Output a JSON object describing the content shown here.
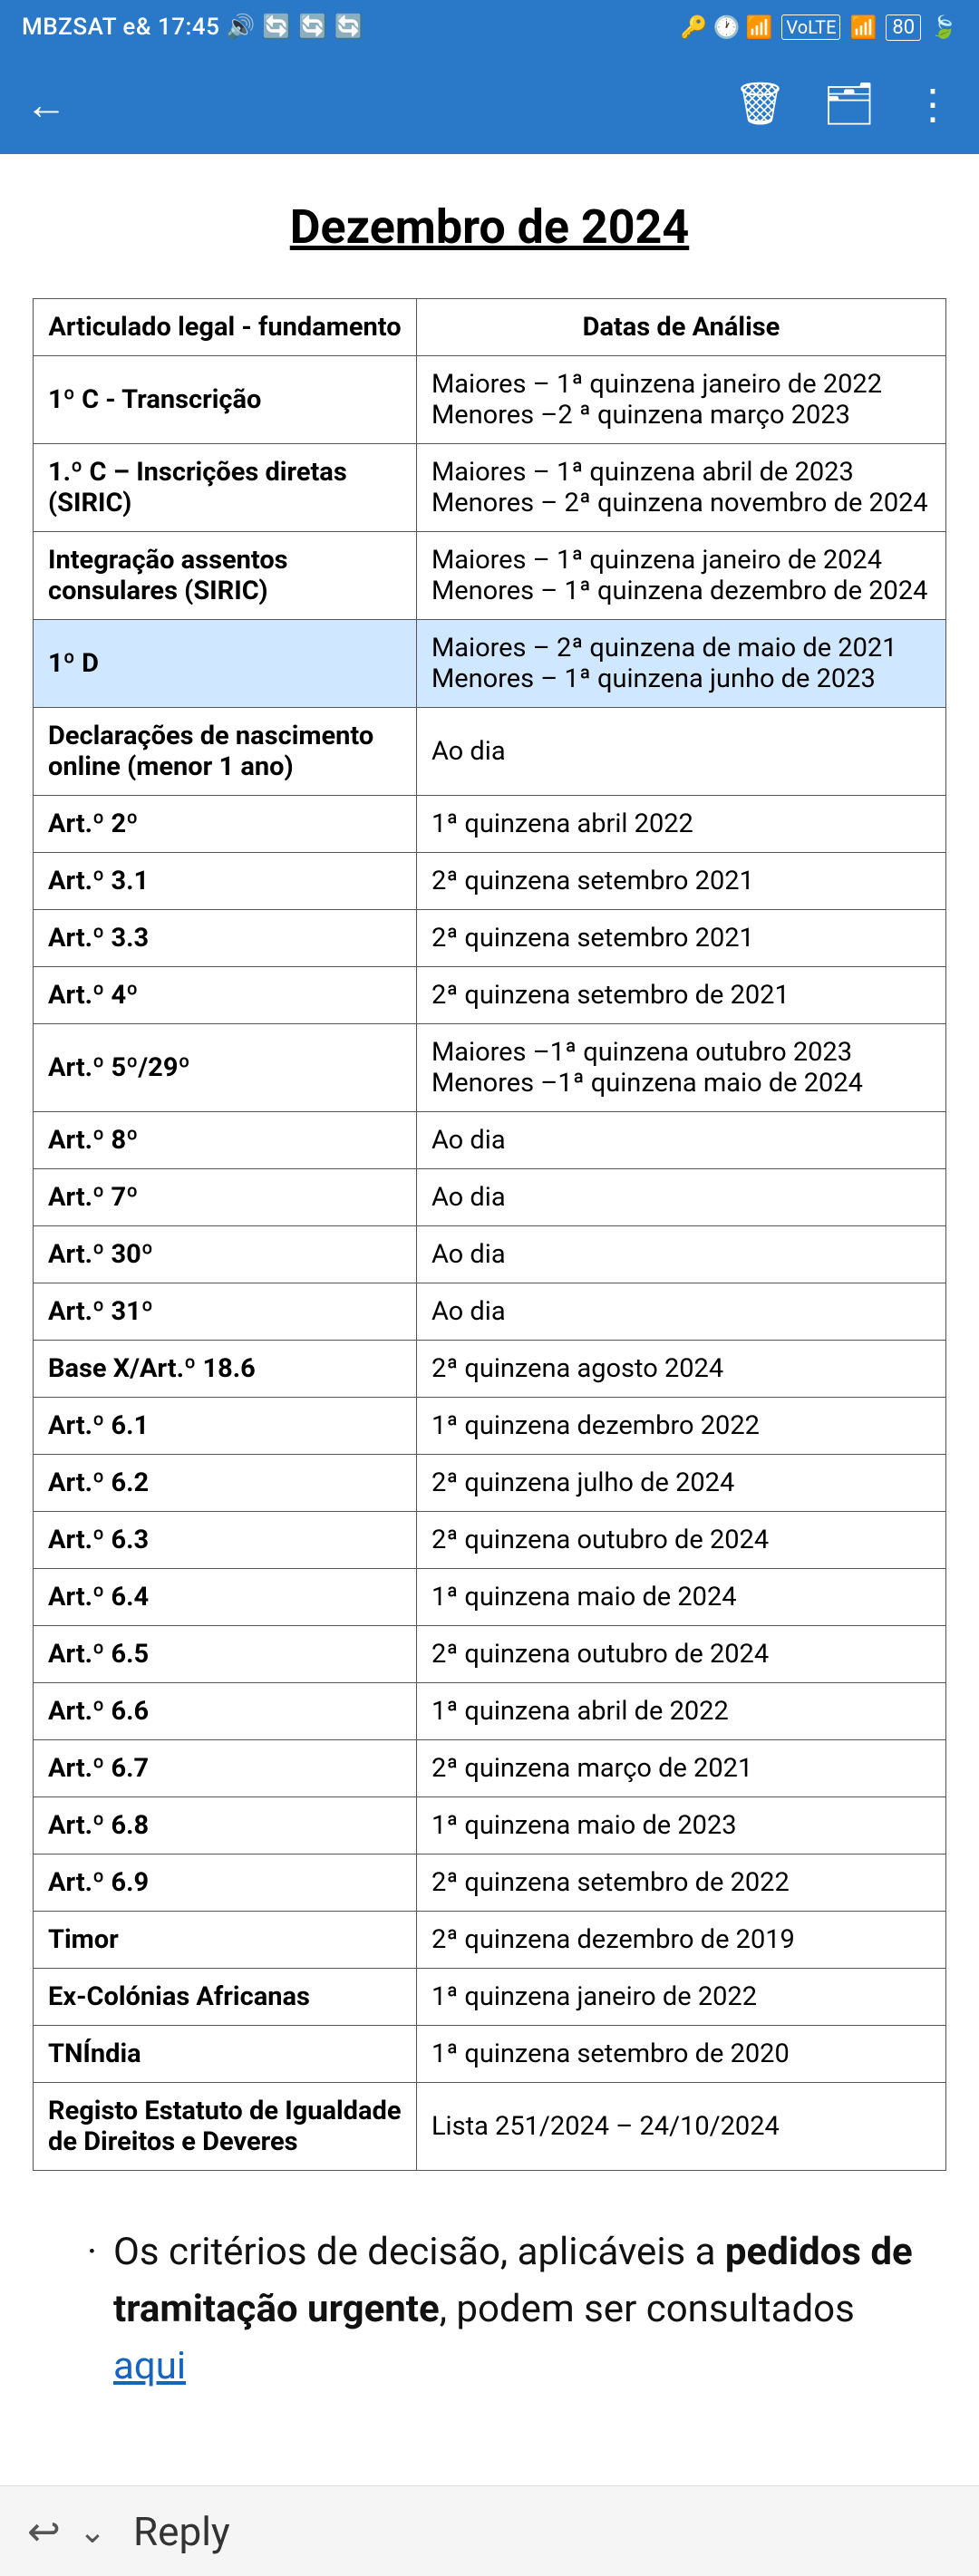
{
  "statusBar": {
    "carrier": "MBZSAT e&",
    "time": "17:45",
    "icons": "🔒 🕐 📶 VoLTE 📶 80"
  },
  "navBar": {
    "backLabel": "←",
    "deleteLabel": "🗑",
    "archiveLabel": "🗂",
    "moreLabel": "⋮"
  },
  "page": {
    "title": "Dezembro de 2024"
  },
  "table": {
    "headers": [
      "Articulado legal - fundamento",
      "Datas de Análise"
    ],
    "rows": [
      {
        "col1": "1º C - Transcrição",
        "col2": "Maiores – 1ª quinzena janeiro de 2022\nMenores –2 ª quinzena março 2023",
        "highlight": false
      },
      {
        "col1": "1.º C – Inscrições diretas (SIRIC)",
        "col2": "Maiores – 1ª quinzena abril de 2023\nMenores – 2ª quinzena novembro de 2024",
        "highlight": false
      },
      {
        "col1": "Integração assentos consulares (SIRIC)",
        "col2": "Maiores – 1ª quinzena janeiro de 2024\nMenores – 1ª quinzena dezembro de 2024",
        "highlight": false
      },
      {
        "col1": "1º D",
        "col2": "Maiores  – 2ª quinzena de maio de 2021\nMenores – 1ª quinzena junho de 2023",
        "highlight": true
      },
      {
        "col1": "Declarações de nascimento online (menor 1 ano)",
        "col2": "Ao dia",
        "highlight": false
      },
      {
        "col1": "Art.º 2º",
        "col2": "1ª quinzena abril 2022",
        "highlight": false
      },
      {
        "col1": "Art.º 3.1",
        "col2": "2ª quinzena setembro 2021",
        "highlight": false
      },
      {
        "col1": "Art.º 3.3",
        "col2": "2ª quinzena setembro 2021",
        "highlight": false
      },
      {
        "col1": "Art.º 4º",
        "col2": "2ª quinzena setembro de 2021",
        "highlight": false
      },
      {
        "col1": "Art.º 5º/29º",
        "col2": "Maiores –1ª quinzena outubro 2023\nMenores –1ª quinzena maio de 2024",
        "highlight": false
      },
      {
        "col1": "Art.º 8º",
        "col2": "Ao dia",
        "highlight": false
      },
      {
        "col1": "Art.º 7º",
        "col2": "Ao dia",
        "highlight": false
      },
      {
        "col1": "Art.º 30º",
        "col2": "Ao dia",
        "highlight": false
      },
      {
        "col1": "Art.º 31º",
        "col2": "Ao dia",
        "highlight": false
      },
      {
        "col1": "Base X/Art.º 18.6",
        "col2": "2ª quinzena agosto 2024",
        "highlight": false
      },
      {
        "col1": "Art.º 6.1",
        "col2": "1ª quinzena dezembro 2022",
        "highlight": false
      },
      {
        "col1": "Art.º 6.2",
        "col2": "2ª quinzena julho de 2024",
        "highlight": false
      },
      {
        "col1": "Art.º 6.3",
        "col2": "2ª quinzena outubro de 2024",
        "highlight": false
      },
      {
        "col1": "Art.º 6.4",
        "col2": "1ª quinzena maio de 2024",
        "highlight": false
      },
      {
        "col1": "Art.º 6.5",
        "col2": "2ª quinzena outubro de 2024",
        "highlight": false
      },
      {
        "col1": "Art.º 6.6",
        "col2": "1ª quinzena abril de 2022",
        "highlight": false
      },
      {
        "col1": "Art.º 6.7",
        "col2": "2ª quinzena março de 2021",
        "highlight": false
      },
      {
        "col1": "Art.º 6.8",
        "col2": "1ª quinzena maio de 2023",
        "highlight": false
      },
      {
        "col1": "Art.º 6.9",
        "col2": "2ª quinzena setembro de 2022",
        "highlight": false
      },
      {
        "col1": "Timor",
        "col2": "2ª quinzena dezembro de 2019",
        "highlight": false
      },
      {
        "col1": "Ex-Colónias Africanas",
        "col2": "1ª quinzena janeiro de 2022",
        "highlight": false
      },
      {
        "col1": "TNÍndia",
        "col2": "1ª quinzena setembro de 2020",
        "highlight": false
      },
      {
        "col1": "Registo Estatuto de Igualdade de Direitos e Deveres",
        "col2": "Lista 251/2024 – 24/10/2024",
        "highlight": false
      }
    ]
  },
  "textSection": {
    "bullet": "·",
    "textPart1": "Os critérios de decisão, aplicáveis a ",
    "boldPart": "pedidos de tramitação urgente",
    "textPart2": ", podem ser consultados ",
    "linkText": "aqui",
    "linkHref": "#"
  },
  "bottomBar": {
    "backIcon": "↩",
    "downIcon": "˅",
    "replyLabel": "Reply"
  }
}
